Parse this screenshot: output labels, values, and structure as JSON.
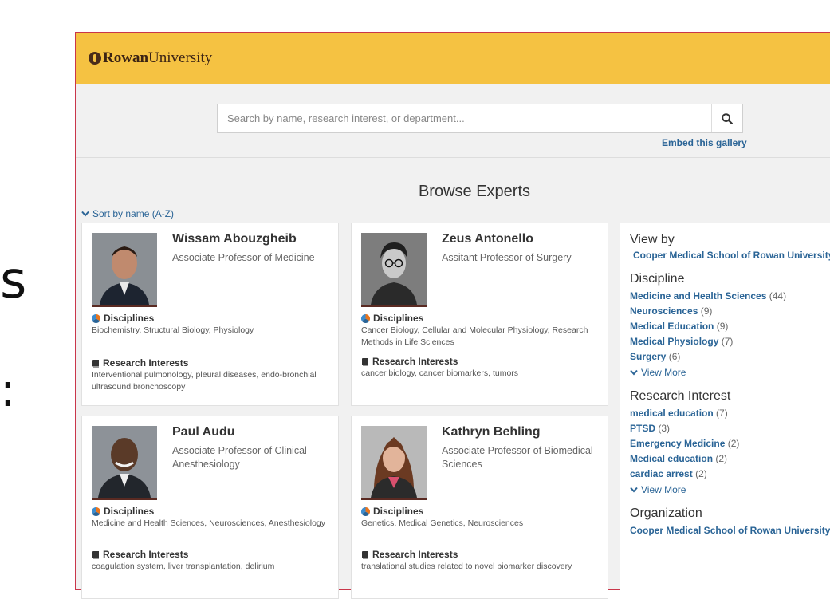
{
  "background": {
    "glyph_top": "s",
    "glyph_bottom": ":"
  },
  "brand": {
    "name_bold": "Rowan",
    "name_regular": "University"
  },
  "search": {
    "placeholder": "Search by name, research interest, or department...",
    "embed_label": "Embed this gallery"
  },
  "page_title": "Browse Experts",
  "sort_label": "Sort by name (A-Z)",
  "experts": [
    {
      "name": "Wissam Abouzgheib",
      "title": "Associate Professor of Medicine",
      "disciplines_label": "Disciplines",
      "disciplines": "Biochemistry, Structural Biology, Physiology",
      "interests_label": "Research Interests",
      "interests": "Interventional pulmonology, pleural diseases, endo-bronchial ultrasound bronchoscopy"
    },
    {
      "name": "Zeus Antonello",
      "title": "Assitant Professor of Surgery",
      "disciplines_label": "Disciplines",
      "disciplines": "Cancer Biology, Cellular and Molecular Physiology, Research Methods in Life Sciences",
      "interests_label": "Research Interests",
      "interests": "cancer biology, cancer biomarkers, tumors"
    },
    {
      "name": "Paul Audu",
      "title": "Associate Professor of Clinical Anesthesiology",
      "disciplines_label": "Disciplines",
      "disciplines": "Medicine and Health Sciences, Neurosciences, Anesthesiology",
      "interests_label": "Research Interests",
      "interests": "coagulation system, liver transplantation, delirium"
    },
    {
      "name": "Kathryn Behling",
      "title": "Associate Professor of Biomedical Sciences",
      "disciplines_label": "Disciplines",
      "disciplines": "Genetics, Medical Genetics, Neurosciences",
      "interests_label": "Research Interests",
      "interests": "translational studies related to novel biomarker discovery"
    }
  ],
  "sidebar": {
    "view_by": {
      "heading": "View by",
      "filter": "Cooper Medical School of Rowan University"
    },
    "discipline": {
      "heading": "Discipline",
      "items": [
        {
          "label": "Medicine and Health Sciences",
          "count": "(44)"
        },
        {
          "label": "Neurosciences",
          "count": "(9)"
        },
        {
          "label": "Medical Education",
          "count": "(9)"
        },
        {
          "label": "Medical Physiology",
          "count": "(7)"
        },
        {
          "label": "Surgery",
          "count": "(6)"
        }
      ],
      "more": "View More"
    },
    "research_interest": {
      "heading": "Research Interest",
      "items": [
        {
          "label": "medical education",
          "count": "(7)"
        },
        {
          "label": "PTSD",
          "count": "(3)"
        },
        {
          "label": "Emergency Medicine",
          "count": "(2)"
        },
        {
          "label": "Medical education",
          "count": "(2)"
        },
        {
          "label": "cardiac arrest",
          "count": "(2)"
        }
      ],
      "more": "View More"
    },
    "organization": {
      "heading": "Organization",
      "first_item": "Cooper Medical School of Rowan University"
    }
  },
  "colors": {
    "brand_yellow": "#f5c242",
    "link_blue": "#2a6496",
    "frame_red": "#c9364a"
  }
}
